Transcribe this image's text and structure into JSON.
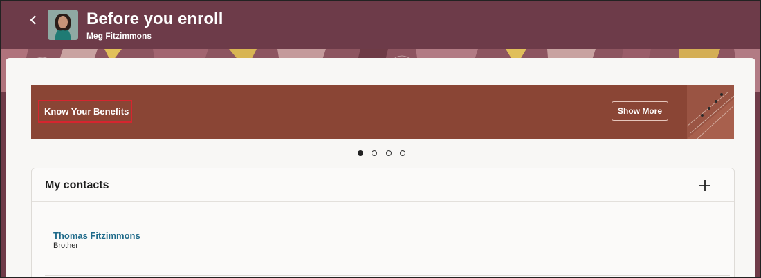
{
  "header": {
    "title": "Before you enroll",
    "subtitle": "Meg Fitzimmons",
    "back_icon": "chevron-left-icon",
    "avatar": "user-avatar-photo"
  },
  "colors": {
    "header_bg": "#6d3b49",
    "banner_bg": "#8a4535",
    "highlight": "#d6252f",
    "link": "#1f6a8a"
  },
  "banner": {
    "title": "Know Your Benefits",
    "button_label": "Show More"
  },
  "carousel": {
    "total": 4,
    "active_index": 0
  },
  "contacts": {
    "title": "My contacts",
    "add_icon": "plus-icon",
    "items": [
      {
        "name": "Thomas Fitzimmons",
        "relation": "Brother"
      }
    ]
  }
}
